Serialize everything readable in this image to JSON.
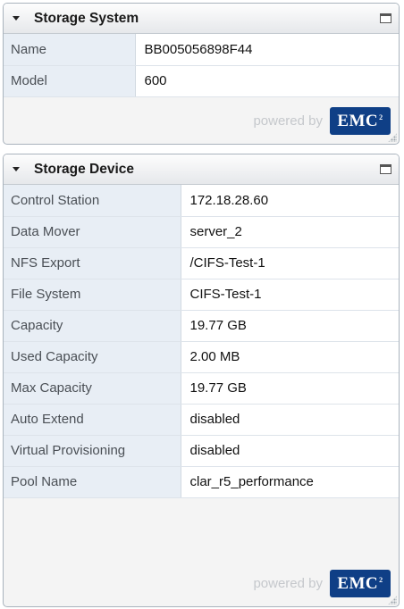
{
  "storage_system": {
    "title": "Storage System",
    "rows": [
      {
        "label": "Name",
        "value": "BB005056898F44"
      },
      {
        "label": "Model",
        "value": "600"
      }
    ],
    "powered_by": "powered by",
    "logo_text": "EMC",
    "logo_sup": "2"
  },
  "storage_device": {
    "title": "Storage Device",
    "rows": [
      {
        "label": "Control Station",
        "value": "172.18.28.60"
      },
      {
        "label": "Data Mover",
        "value": "server_2"
      },
      {
        "label": "NFS Export",
        "value": "/CIFS-Test-1"
      },
      {
        "label": "File System",
        "value": "CIFS-Test-1"
      },
      {
        "label": "Capacity",
        "value": "19.77 GB"
      },
      {
        "label": "Used Capacity",
        "value": "2.00 MB"
      },
      {
        "label": "Max Capacity",
        "value": "19.77 GB"
      },
      {
        "label": "Auto Extend",
        "value": "disabled"
      },
      {
        "label": "Virtual Provisioning",
        "value": "disabled"
      },
      {
        "label": "Pool Name",
        "value": "clar_r5_performance"
      }
    ],
    "powered_by": "powered by",
    "logo_text": "EMC",
    "logo_sup": "2"
  },
  "colors": {
    "header_gradient_top": "#fdfdfd",
    "header_gradient_bottom": "#e6e8eb",
    "label_bg": "#e8eef5",
    "emc_blue": "#0f3f86"
  },
  "icons": [
    "collapse-triangle-icon",
    "maximize-icon",
    "resize-grip-icon"
  ]
}
